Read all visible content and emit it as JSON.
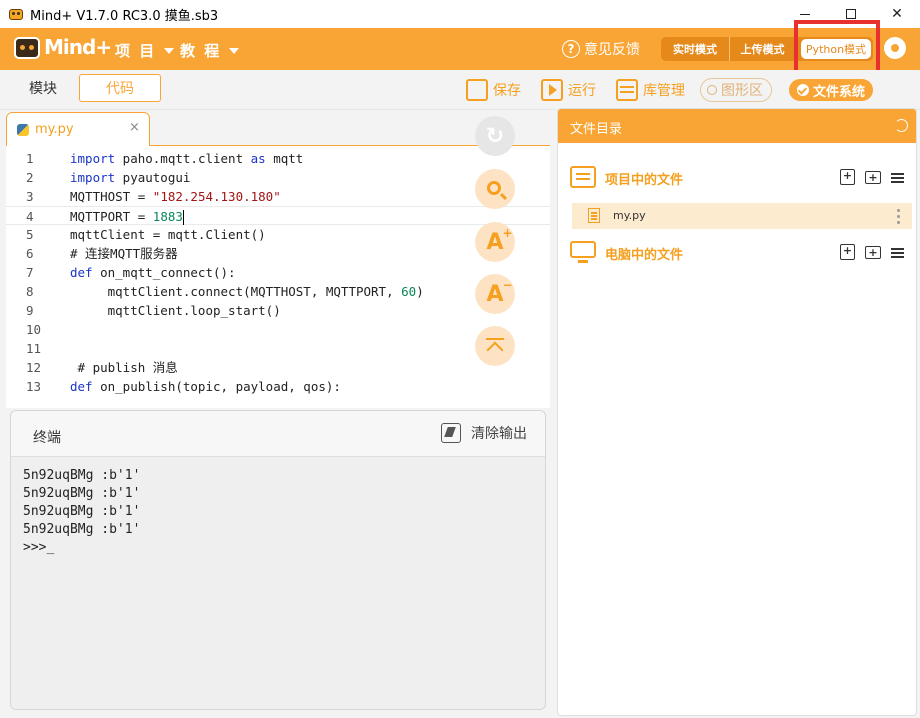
{
  "window": {
    "title": "Mind+ V1.7.0 RC3.0   摸鱼.sb3"
  },
  "header": {
    "logo_text": "Mind+",
    "menu": [
      {
        "label": "项 目"
      },
      {
        "label": "教 程"
      }
    ],
    "feedback_label": "意见反馈",
    "modes": [
      {
        "label": "实时模式"
      },
      {
        "label": "上传模式"
      },
      {
        "label": "Python模式"
      }
    ],
    "accent_color": "#f9a535",
    "highlight_color": "#e8302e"
  },
  "toolbar": {
    "blocks_tab": "模块",
    "code_tab": "代码",
    "save_label": "保存",
    "run_label": "运行",
    "library_label": "库管理",
    "graphics_label": "图形区",
    "filesystem_label": "文件系统"
  },
  "editor": {
    "tab_name": "my.py",
    "tab_close": "×",
    "lines": [
      {
        "n": "1"
      },
      {
        "n": "2"
      },
      {
        "n": "3"
      },
      {
        "n": "4"
      },
      {
        "n": "5"
      },
      {
        "n": "6"
      },
      {
        "n": "7"
      },
      {
        "n": "8"
      },
      {
        "n": "9"
      },
      {
        "n": "10"
      },
      {
        "n": "11"
      },
      {
        "n": "12"
      },
      {
        "n": "13"
      }
    ],
    "code": {
      "l1_kw1": "import",
      "l1_mod": " paho.mqtt.client ",
      "l1_kw2": "as",
      "l1_alias": " mqtt",
      "l2_kw": "import",
      "l2_mod": " pyautogui",
      "l3_var": "MQTTHOST = ",
      "l3_str": "\"182.254.130.180\"",
      "l4_var": "MQTTPORT = ",
      "l4_num": "1883",
      "l5": "mqttClient = mqtt.Client()",
      "l6": "# 连接MQTT服务器",
      "l7_kw": "def",
      "l7_rest": " on_mqtt_connect():",
      "l8_a": "     mqttClient.connect(MQTTHOST, MQTTPORT, ",
      "l8_num": "60",
      "l8_b": ")",
      "l9": "     mqttClient.loop_start()",
      "l12": " # publish 消息",
      "l13_kw": "def",
      "l13_rest": " on_publish(topic, payload, qos):"
    }
  },
  "terminal": {
    "title": "终端",
    "clear_label": "清除输出",
    "output": [
      "5n92uqBMg :b'1'",
      "5n92uqBMg :b'1'",
      "5n92uqBMg :b'1'",
      "5n92uqBMg :b'1'",
      ">>>_"
    ]
  },
  "file_panel": {
    "title": "文件目录",
    "project_section": "项目中的文件",
    "project_files": [
      {
        "name": "my.py"
      }
    ],
    "computer_section": "电脑中的文件"
  }
}
